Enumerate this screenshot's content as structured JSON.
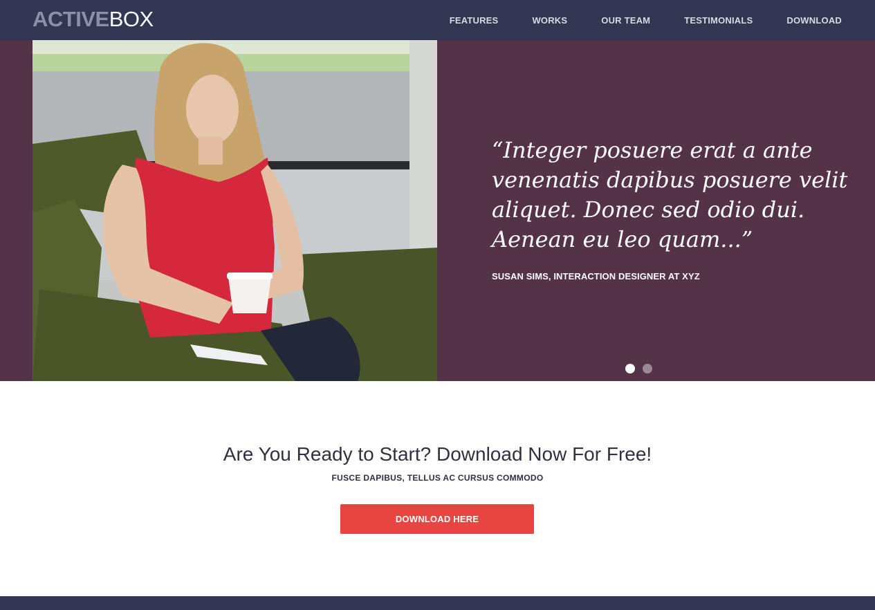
{
  "header": {
    "logo_bold": "ACTIVE",
    "logo_light": "BOX",
    "nav": [
      "FEATURES",
      "WORKS",
      "OUR TEAM",
      "TESTIMONIALS",
      "DOWNLOAD"
    ]
  },
  "testimonial": {
    "quote": "“Integer posuere erat a ante venenatis dapibus posuere velit aliquet. Donec sed odio dui. Aenean eu leo quam...”",
    "author": "SUSAN SIMS, INTERACTION DESIGNER AT XYZ",
    "slides": 2,
    "active_slide": 1
  },
  "cta": {
    "title": "Are You Ready to Start? Download Now For Free!",
    "subtitle": "FUSCE DAPIBUS, TELLUS AC CURSUS COMMODO",
    "button_label": "DOWNLOAD HERE"
  },
  "colors": {
    "nav_bg": "#323652",
    "testimonial_bg": "#543349",
    "button": "#e74442"
  }
}
